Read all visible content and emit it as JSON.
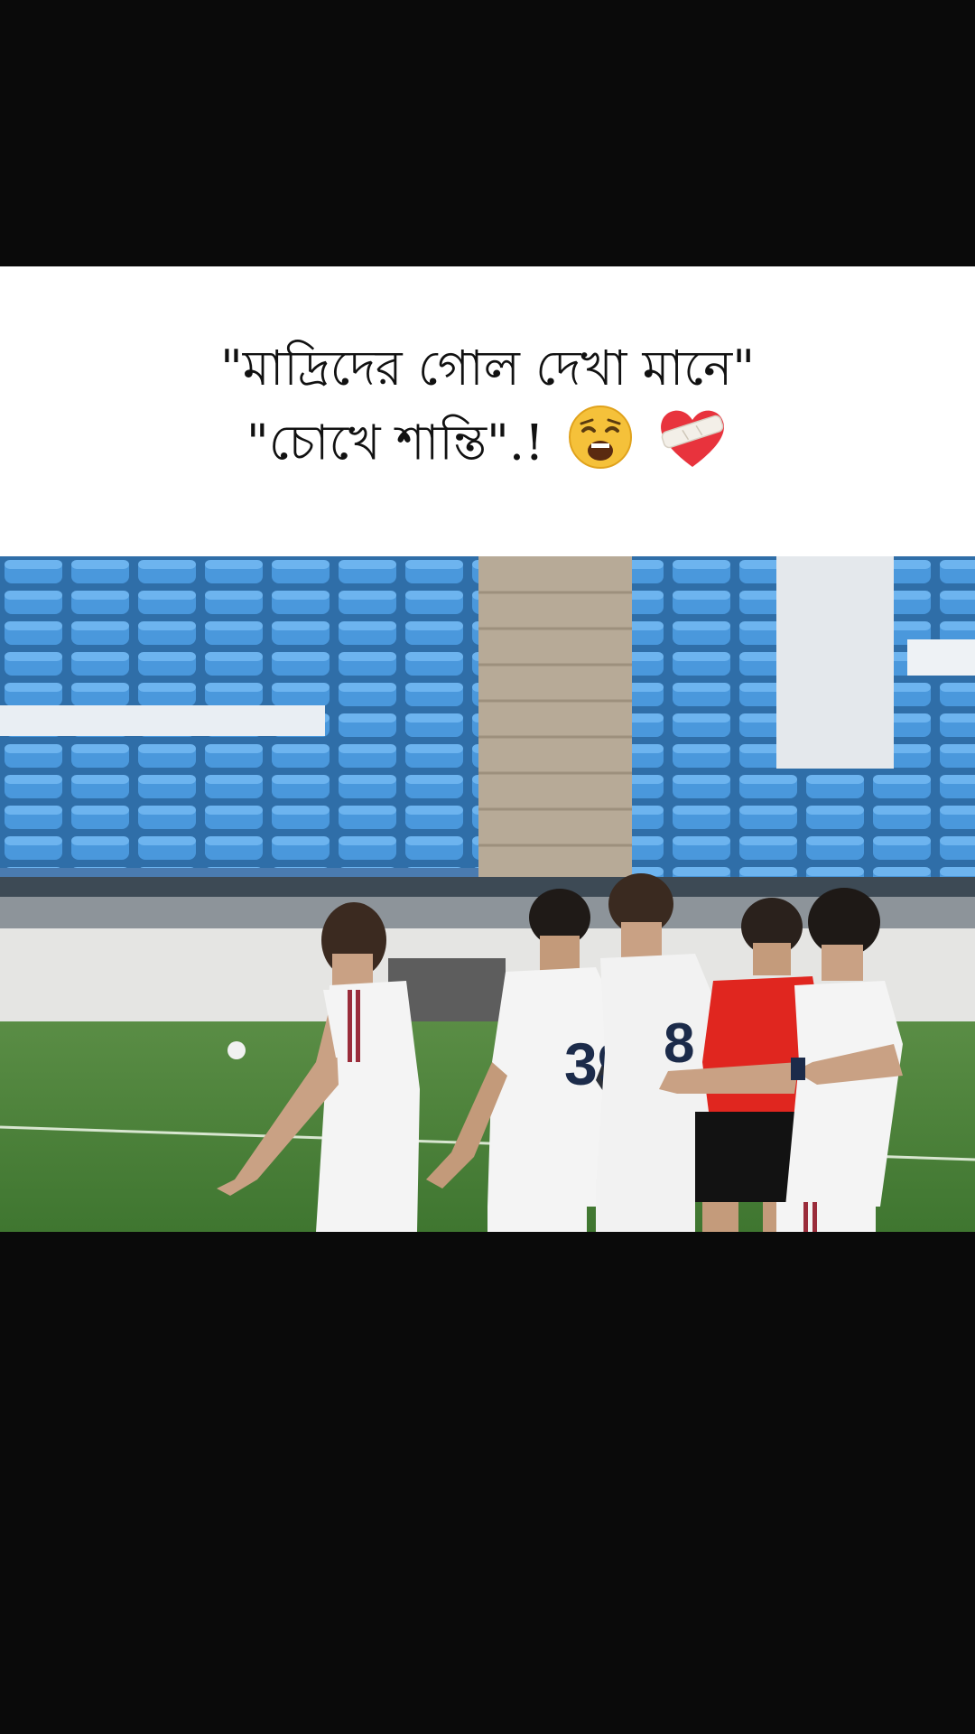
{
  "caption": {
    "line1": "\"মাদ্রিদের গোল দেখা মানে\"",
    "line2": "\"চোখে শান্তি\".!"
  },
  "emojis": [
    "weary-face-icon",
    "mending-heart-icon"
  ],
  "video": {
    "jersey_numbers": [
      "39",
      "8"
    ]
  },
  "colors": {
    "background": "#0a0a0a",
    "caption_bg": "#ffffff",
    "seat_blue": "#3a86c8",
    "pitch_green": "#4f8a3a",
    "referee_red": "#e0261f"
  }
}
